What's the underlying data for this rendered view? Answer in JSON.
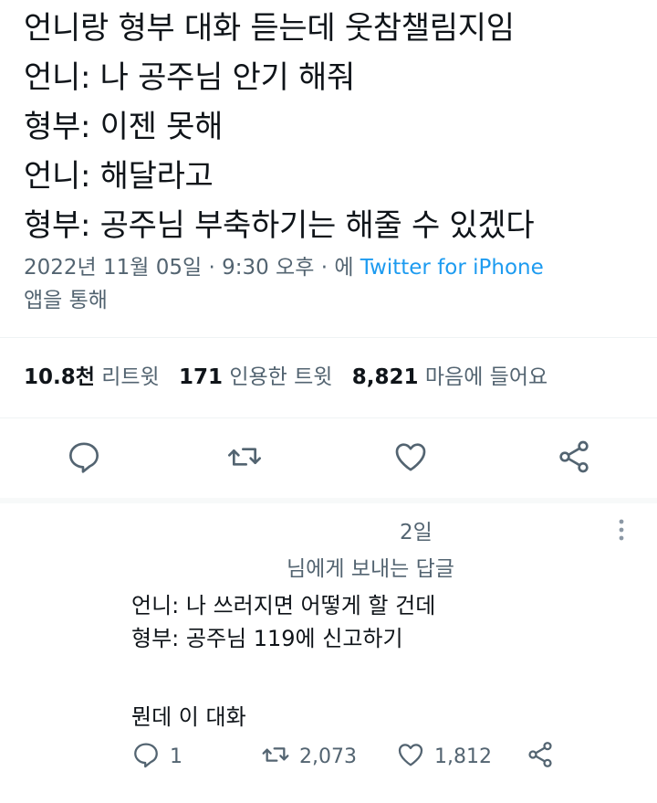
{
  "tweet": {
    "lines": [
      "언니랑 형부 대화 듣는데 웃참챌림지임",
      "언니: 나 공주님 안기 해줘",
      "형부: 이젠 못해",
      "언니: 해달라고",
      "형부: 공주님 부축하기는 해줄 수 있겠다"
    ],
    "timestamp": "2022년 11월 05일 · 9:30 오후 · 에",
    "via_app": "Twitter for iPhone",
    "via_suffix": "앱을 통해"
  },
  "stats": {
    "retweets": "10.8천",
    "retweets_label": "리트윗",
    "quotes": "171",
    "quotes_label": "인용한 트윗",
    "likes": "8,821",
    "likes_label": "마음에 들어요"
  },
  "actions": [
    "reply-icon",
    "retweet-icon",
    "like-icon",
    "share-icon"
  ],
  "reply": {
    "time": "2일",
    "replying_to": "님에게 보내는 답글",
    "lines": [
      "언니: 나 쓰러지면 어떻게 할 건데",
      "형부: 공주님 119에 신고하기",
      "",
      "뭔데 이 대화"
    ],
    "reply_count": "1",
    "retweet_count": "2,073",
    "like_count": "1,812"
  },
  "colors": {
    "text": "#0f1419",
    "secondary": "#536471",
    "link": "#1d9bf0"
  }
}
